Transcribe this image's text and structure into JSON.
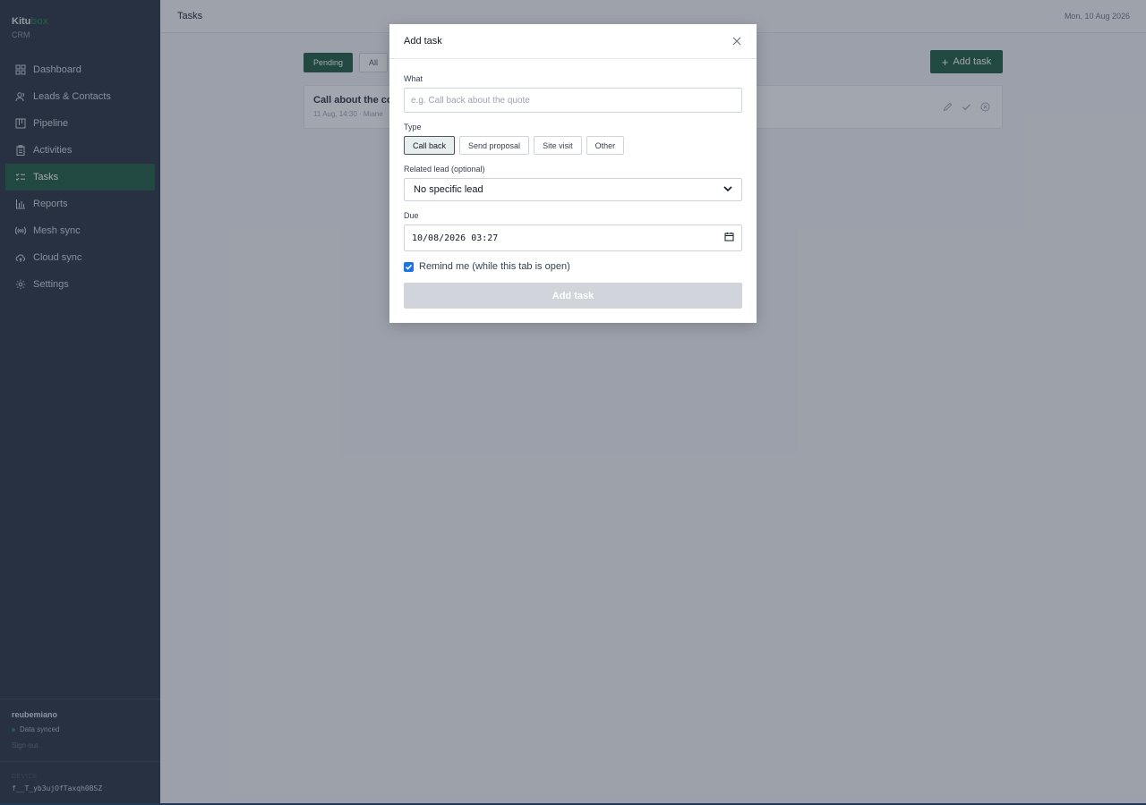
{
  "brand": {
    "name": "Kitu",
    "name_accent": "box",
    "subtitle": "CRM"
  },
  "sidebar": {
    "items": [
      {
        "label": "Dashboard",
        "icon": "grid-icon"
      },
      {
        "label": "Leads & Contacts",
        "icon": "users-icon"
      },
      {
        "label": "Pipeline",
        "icon": "kanban-icon"
      },
      {
        "label": "Activities",
        "icon": "clipboard-icon"
      },
      {
        "label": "Tasks",
        "icon": "checklist-icon",
        "active": true
      },
      {
        "label": "Reports",
        "icon": "bar-chart-icon"
      },
      {
        "label": "Mesh sync",
        "icon": "broadcast-icon"
      },
      {
        "label": "Cloud sync",
        "icon": "cloud-sync-icon"
      },
      {
        "label": "Settings",
        "icon": "gear-icon"
      }
    ],
    "footer": {
      "username": "reubemiano",
      "sync_status": "Data synced",
      "sign_out": "Sign out",
      "device_label": "DEVICE",
      "device_id": "f__T_yb3ujOfTaxqh0BSZ"
    }
  },
  "topbar": {
    "title": "Tasks",
    "date": "Mon, 10 Aug 2026"
  },
  "filters": {
    "pending": "Pending",
    "all": "All"
  },
  "add_task_button": "Add task",
  "task": {
    "title": "Call about the co",
    "meta": "11 Aug, 14:30 · Miane"
  },
  "modal": {
    "title": "Add task",
    "what_label": "What",
    "what_placeholder": "e.g. Call back about the quote",
    "what_value": "",
    "type_label": "Type",
    "types": [
      "Call back",
      "Send proposal",
      "Site visit",
      "Other"
    ],
    "selected_type": "Call back",
    "related_label": "Related lead (optional)",
    "related_value": "No specific lead",
    "due_label": "Due",
    "due_value": "10/08/2026 03:27",
    "remind_label": "Remind me (while this tab is open)",
    "remind_checked": true,
    "submit": "Add task"
  },
  "colors": {
    "sidebar_bg": "#202a3a",
    "accent": "#17563a",
    "checkbox": "#1a73e8"
  }
}
